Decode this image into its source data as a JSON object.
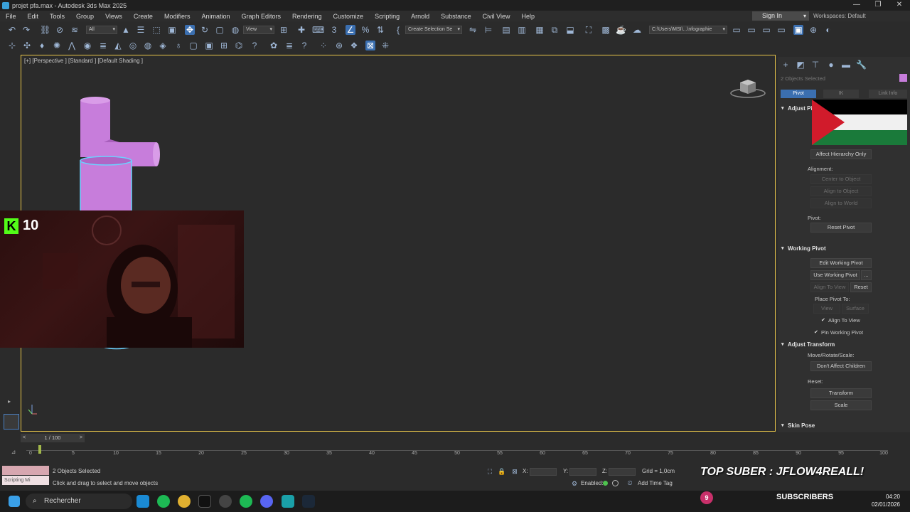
{
  "window": {
    "title": "projet pfa.max - Autodesk 3ds Max 2025"
  },
  "menu": [
    "File",
    "Edit",
    "Tools",
    "Group",
    "Views",
    "Create",
    "Modifiers",
    "Animation",
    "Graph Editors",
    "Rendering",
    "Customize",
    "Scripting",
    "Arnold",
    "Substance",
    "Civil View",
    "Help"
  ],
  "account": {
    "signin_label": "Sign In",
    "workspaces_label": "Workspaces: Default"
  },
  "toolbar": {
    "filter_value": "All",
    "view_value": "View",
    "selection_set_placeholder": "Create Selection Se",
    "path_value": "C:\\Users\\MSI\\...\\nfographie"
  },
  "viewport": {
    "label": "[+] [Perspective ] [Standard ] [Default Shading ]"
  },
  "overlay": {
    "kick_count": "10",
    "top_suber": "TOP SUBER : JFLOW4REALL!",
    "subscribers_label": "SUBSCRIBERS",
    "subscribers_count": "9"
  },
  "command_panel": {
    "selection_info": "2 Objects Selected",
    "tabs": [
      "Pivot",
      "IK",
      "Link Info"
    ],
    "adjust_pivot_title": "Adjust Pivot",
    "affect_hierarchy_label": "Affect Hierarchy Only",
    "alignment_label": "Alignment:",
    "center_to_object": "Center to Object",
    "align_to_object": "Align to Object",
    "align_to_world": "Align to World",
    "pivot_label": "Pivot:",
    "reset_pivot": "Reset Pivot",
    "working_pivot_title": "Working Pivot",
    "edit_working_pivot": "Edit Working Pivot",
    "use_working_pivot": "Use Working Pivot",
    "ellipsis": "...",
    "align_to_view_btn": "Align To View",
    "reset_btn": "Reset",
    "place_pivot_to": "Place Pivot To:",
    "view_btn": "View",
    "surface_btn": "Surface",
    "align_to_view_check": "Align To View",
    "pin_working_pivot": "Pin Working Pivot",
    "adjust_transform_title": "Adjust Transform",
    "move_rotate_scale": "Move/Rotate/Scale:",
    "dont_affect_children": "Don't Affect Children",
    "reset_label": "Reset:",
    "transform_btn": "Transform",
    "scale_btn": "Scale",
    "skin_pose_title": "Skin Pose"
  },
  "timeline": {
    "slider": "1 / 100",
    "ticks": [
      "0",
      "5",
      "10",
      "15",
      "20",
      "25",
      "30",
      "35",
      "40",
      "45",
      "50",
      "55",
      "60",
      "65",
      "70",
      "75",
      "80",
      "85",
      "90",
      "95",
      "100"
    ]
  },
  "status": {
    "maxscript_label": "Scripting Mi",
    "objects_selected": "2 Objects Selected",
    "prompt": "Click and drag to select and move objects",
    "x_label": "X:",
    "y_label": "Y:",
    "z_label": "Z:",
    "grid": "Grid = 1,0cm",
    "enabled_label": "Enabled:",
    "add_time_tag": "Add Time Tag"
  },
  "taskbar": {
    "search_placeholder": "Rechercher",
    "time": "04:20",
    "date": "02/01/2026"
  },
  "colors": {
    "accent": "#3b6fb0",
    "viewport_border": "#e8c64a",
    "object": "#c77ddb",
    "kick": "#53fc18"
  }
}
